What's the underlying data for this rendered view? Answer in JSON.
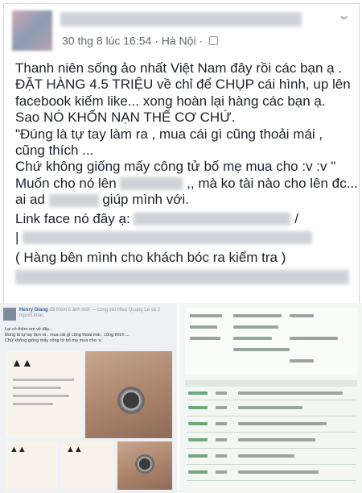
{
  "post": {
    "timestamp": "30 thg 8 lúc 16:54",
    "separator": "·",
    "location": "Hà Nội",
    "lines": [
      "Thanh niên sống ảo nhất Việt Nam đây rồi các bạn ạ .",
      "ĐẶT HÀNG 4.5 TRIỆU về chỉ để CHỤP cái hình, up lên",
      "facebook kiếm like... xong hoàn lại hàng các bạn ạ.",
      "Sao NÓ KHỐN NẠN THẾ CƠ CHỨ.",
      "\"Đúng là tự tay làm ra , mua cái gì cũng thoải mái ,",
      "cũng thích ...",
      "Chứ không giống mấy công tử bố mẹ mua cho :v :v \""
    ],
    "line8_before": "Muốn cho nó lên",
    "line8_after": ",, mà ko tài nào cho lên đc...",
    "line9_before": "ai ad",
    "line9_after": "giúp mình với.",
    "line10_before": "Link face nó đây ạ:",
    "line10_after": "/",
    "line11_prefix": "|",
    "line12": "( Hàng bên mình cho khách bóc ra kiểm tra )"
  },
  "embedded_left": {
    "author": "Henry Giang",
    "action": "đã thêm 5 ảnh mới — cùng với Hieu Quang Le và 2 người khác.",
    "text_lines": [
      "Lại có thêm em về đây...",
      "Đúng là tự tay làm ra , mua cái gì cũng thoải mái , cũng thích ...",
      "Chứ không giống mấy công tử bố mẹ mua cho :v"
    ]
  },
  "colors": {
    "text": "#1d2129",
    "meta": "#616770",
    "link": "#365899",
    "border": "#d3d6db"
  },
  "icons": {
    "privacy": "globe-icon",
    "menu": "chevron-down-icon"
  }
}
